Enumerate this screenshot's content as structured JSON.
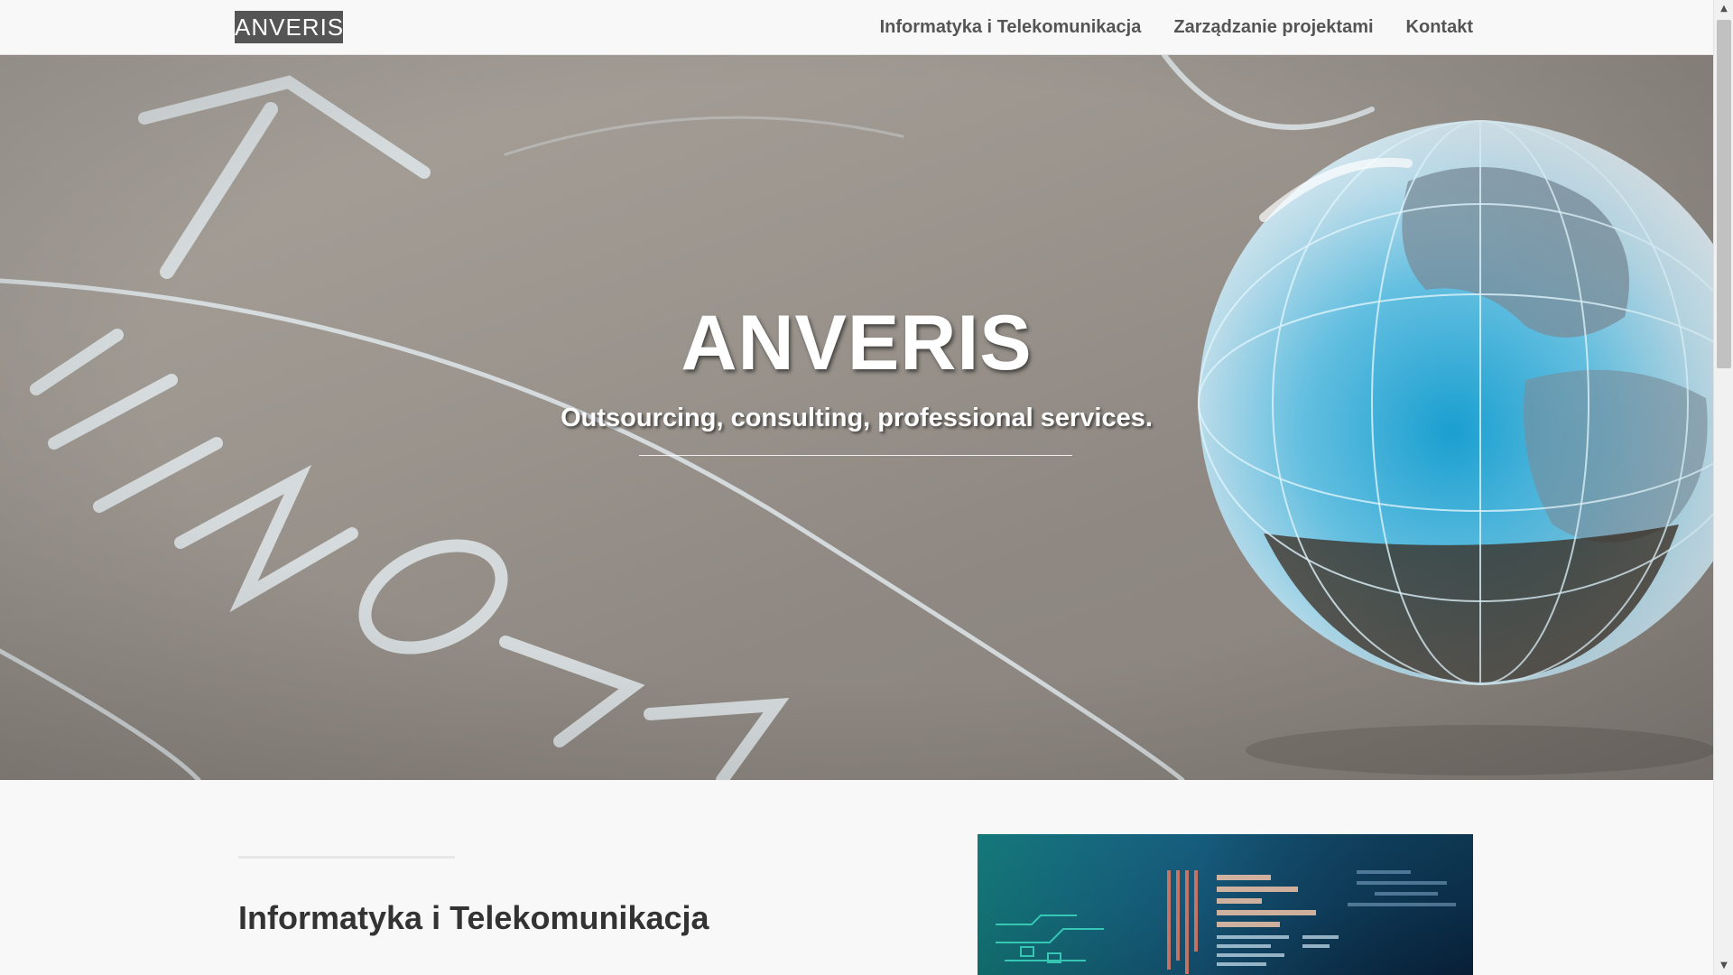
{
  "navbar": {
    "brand": "ANVERIS",
    "links": [
      {
        "label": "Informatyka i Telekomunikacja"
      },
      {
        "label": "Zarządzanie projektami"
      },
      {
        "label": "Kontakt"
      }
    ]
  },
  "hero": {
    "title": "ANVERIS",
    "subtitle": "Outsourcing, consulting, professional services.",
    "background_icons": [
      "chalkboard-drawing",
      "glass-globe"
    ]
  },
  "section": {
    "heading": "Informatyka i Telekomunikacja",
    "image_icon": "circuit-code-image"
  },
  "colors": {
    "page_bg": "#f8f8f8",
    "brand_bg": "#555555",
    "nav_text": "#555555",
    "heading_text": "#333333",
    "hero_text": "#ffffff",
    "globe_accent": "#2fa8d6"
  }
}
